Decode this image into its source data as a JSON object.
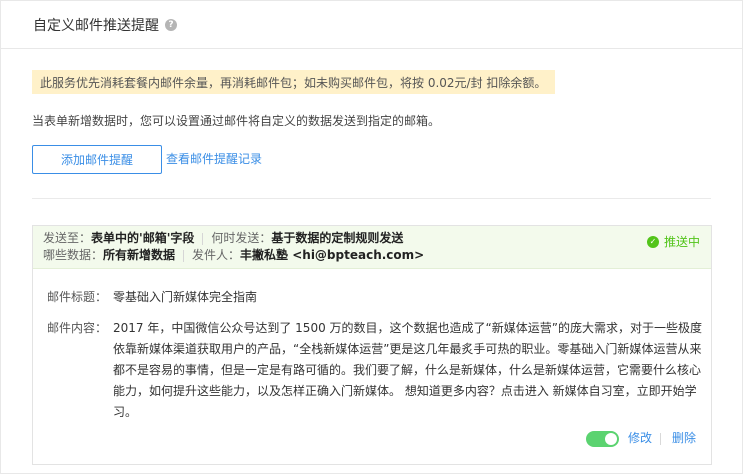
{
  "header": {
    "title": "自定义邮件推送提醒",
    "help_icon": "question-circle-icon"
  },
  "notice": {
    "text": "此服务优先消耗套餐内邮件余量，再消耗邮件包；如未购买邮件包，将按 0.02元/封 扣除余额。",
    "bg_color": "#fff1c9"
  },
  "description": "当表单新增数据时，您可以设置通过邮件将自定义的数据发送到指定的邮箱。",
  "actions": {
    "add_label": "添加邮件提醒",
    "history_label": "查看邮件提醒记录"
  },
  "rule": {
    "send_to_label": "发送至：",
    "send_to_value": "表单中的'邮箱'字段",
    "when_label": "何时发送：",
    "when_value": "基于数据的定制规则发送",
    "data_label": "哪些数据：",
    "data_value": "所有新增数据",
    "sender_label": "发件人：",
    "sender_value": "丰撇私塾 <hi@bpteach.com>",
    "status": "推送中",
    "status_color": "#52c41a",
    "subject_label": "邮件标题：",
    "subject_value": "零基础入门新媒体完全指南",
    "content_label": "邮件内容：",
    "content_value": "2017 年，中国微信公众号达到了 1500 万的数目，这个数据也造成了“新媒体运营”的庞大需求，对于一些极度依靠新媒体渠道获取用户的产品，“全栈新媒体运营”更是这几年最炙手可热的职业。零基础入门新媒体运营从来都不是容易的事情，但是一定是有路可循的。我们要了解，什么是新媒体，什么是新媒体运营，它需要什么核心能力，如何提升这些能力，以及怎样正确入门新媒体。 想知道更多内容？点击进入 新媒体自习室，立即开始学习。",
    "enabled": true,
    "edit_label": "修改",
    "delete_label": "删除"
  },
  "accent_color": "#3a8ee6"
}
